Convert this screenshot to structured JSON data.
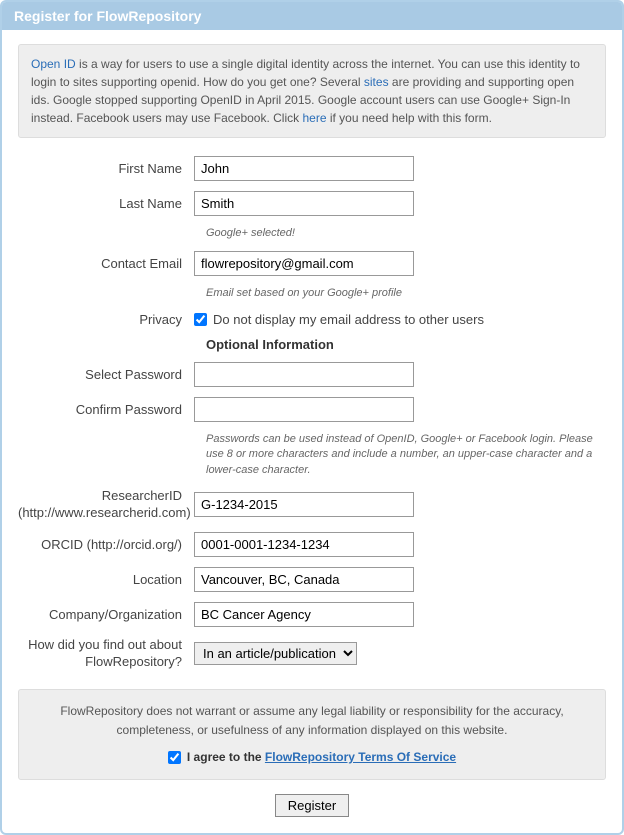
{
  "header": {
    "title": "Register for FlowRepository"
  },
  "info": {
    "link_openid": "Open ID",
    "t1a": " is a way for users to use a single digital identity across the internet. You can use this identity to login to sites supporting openid. How do you get one? Several ",
    "link_sites": "sites",
    "t1b": " are providing and supporting open ids. Google stopped supporting OpenID in April 2015. Google account users can use Google+ Sign-In instead. Facebook users may use Facebook. Click ",
    "link_here": "here",
    "t1c": " if you need help with this form."
  },
  "form": {
    "first_name": {
      "label": "First Name",
      "value": "John"
    },
    "last_name": {
      "label": "Last Name",
      "value": "Smith"
    },
    "gplus_hint": "Google+ selected!",
    "email": {
      "label": "Contact Email",
      "value": "flowrepository@gmail.com"
    },
    "email_hint": "Email set based on your Google+ profile",
    "privacy": {
      "label": "Privacy",
      "checkbox_label": "Do not display my email address to other users",
      "checked": true
    },
    "optional_title": "Optional Information",
    "password": {
      "label": "Select Password",
      "value": ""
    },
    "confirm_password": {
      "label": "Confirm Password",
      "value": ""
    },
    "password_hint": "Passwords can be used instead of OpenID, Google+ or Facebook login. Please use 8 or more characters and include a number, an upper-case character and a lower-case character.",
    "researcher_id": {
      "label_l1": "ResearcherID",
      "label_l2": "(http://www.researcherid.com)",
      "value": "G-1234-2015"
    },
    "orcid": {
      "label": "ORCID (http://orcid.org/)",
      "value": "0001-0001-1234-1234"
    },
    "location": {
      "label": "Location",
      "value": "Vancouver, BC, Canada"
    },
    "company": {
      "label": "Company/Organization",
      "value": "BC Cancer Agency"
    },
    "findout": {
      "label_l1": "How did you find out about",
      "label_l2": "FlowRepository?",
      "selected": "In an article/publication"
    }
  },
  "disclaimer": {
    "text": "FlowRepository does not warrant or assume any legal liability or responsibility for the accuracy, completeness, or usefulness of any information displayed on this website.",
    "agree_prefix": "I agree to the ",
    "terms_link": "FlowRepository Terms Of Service",
    "agree_checked": true
  },
  "submit": {
    "label": "Register"
  }
}
